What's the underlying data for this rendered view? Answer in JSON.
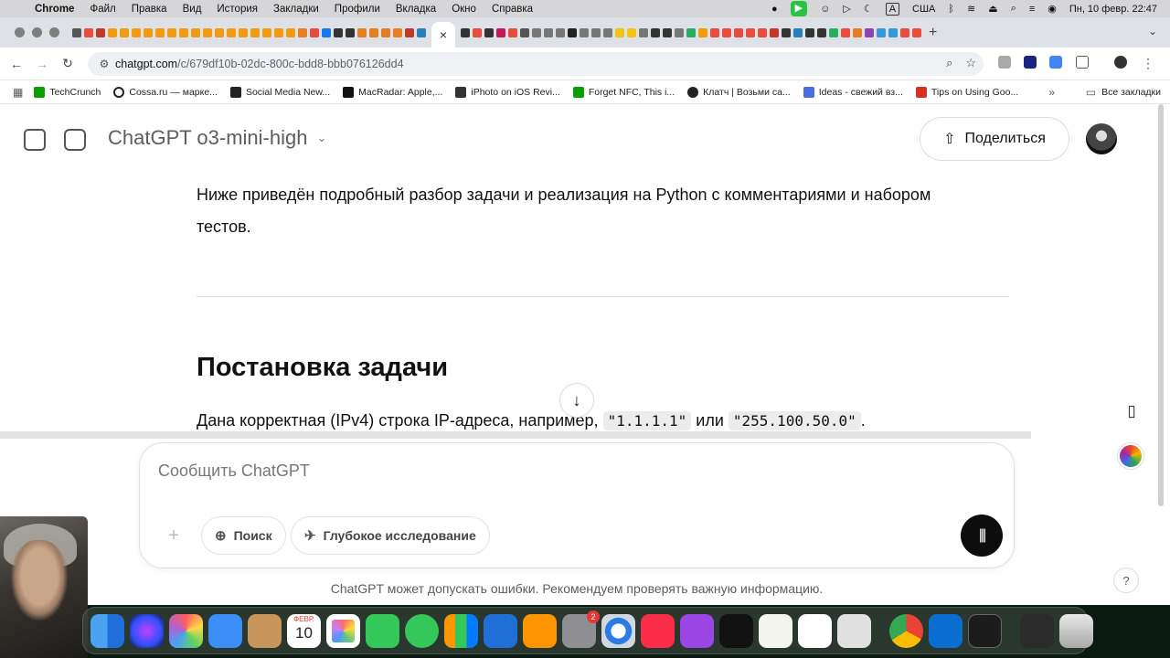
{
  "menubar": {
    "app": "Chrome",
    "items": [
      "Файл",
      "Правка",
      "Вид",
      "История",
      "Закладки",
      "Профили",
      "Вкладка",
      "Окно",
      "Справка"
    ],
    "keyboard": "A",
    "layout": "США",
    "datetime": "Пн, 10 февр.  22:47"
  },
  "browser": {
    "active_tab_close": "×",
    "new_tab": "+",
    "url_host": "chatgpt.com",
    "url_path": "/c/679df10b-02dc-800c-bdd8-bbb076126dd4",
    "bookmarks": [
      {
        "label": "TechCrunch",
        "color": "#0a9e01"
      },
      {
        "label": "Cossa.ru — марке...",
        "color": "#222222"
      },
      {
        "label": "Social Media New...",
        "color": "#222222"
      },
      {
        "label": "MacRadar: Apple,...",
        "color": "#111111"
      },
      {
        "label": "iPhoto on iOS Revi...",
        "color": "#333333"
      },
      {
        "label": "Forget NFC, This i...",
        "color": "#0a9e01"
      },
      {
        "label": "Клатч | Возьми са...",
        "color": "#222222"
      },
      {
        "label": "Ideas - свежий вз...",
        "color": "#4a6ee0"
      },
      {
        "label": "Tips on Using Goo...",
        "color": "#d93025"
      }
    ],
    "all_bookmarks": "Все закладки"
  },
  "chat": {
    "model": "ChatGPT o3-mini-high",
    "share": "Поделиться",
    "intro": "Ниже приведён подробный разбор задачи и реализация на Python с комментариями и набором тестов.",
    "heading": "Постановка задачи",
    "task_prefix": "Дана корректная (IPv4) строка IP-адреса, например, ",
    "code1": "\"1.1.1.1\"",
    "task_or": " или ",
    "code2": "\"255.100.50.0\"",
    "task_suffix": ".",
    "composer_placeholder": "Сообщить ChatGPT",
    "search_label": "Поиск",
    "deep_research_label": "Глубокое исследование",
    "disclaimer": "ChatGPT может допускать ошибки. Рекомендуем проверять важную информацию.",
    "help": "?"
  },
  "dock": {
    "calendar_month": "ФЕВР.",
    "calendar_day": "10",
    "settings_badge": "2"
  }
}
